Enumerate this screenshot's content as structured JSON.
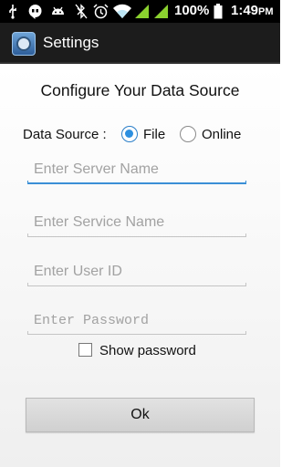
{
  "status_bar": {
    "battery_percent": "100%",
    "time": "1:49",
    "time_suffix": "PM",
    "icons": [
      "usb-icon",
      "hangouts-icon",
      "android-debug-icon",
      "bluetooth-off-icon",
      "alarm-icon",
      "wifi-icon",
      "signal-icon",
      "signal-icon",
      "battery-icon"
    ]
  },
  "action_bar": {
    "title": "Settings",
    "icon": "settings-app-icon"
  },
  "form": {
    "heading": "Configure Your Data Source",
    "data_source_label": "Data Source :",
    "options": [
      {
        "label": "File",
        "selected": true
      },
      {
        "label": "Online",
        "selected": false
      }
    ],
    "server_name": {
      "placeholder": "Enter Server Name",
      "value": ""
    },
    "service_name": {
      "placeholder": "Enter Service Name",
      "value": ""
    },
    "user_id": {
      "placeholder": "Enter User ID",
      "value": ""
    },
    "password": {
      "placeholder": "Enter Password",
      "value": ""
    },
    "show_password": {
      "label": "Show password",
      "checked": false
    },
    "ok_label": "Ok"
  },
  "colors": {
    "accent": "#2c8fe0",
    "status_bar": "#000000",
    "action_bar": "#1c1c1c",
    "signal_green": "#8bd12f"
  }
}
